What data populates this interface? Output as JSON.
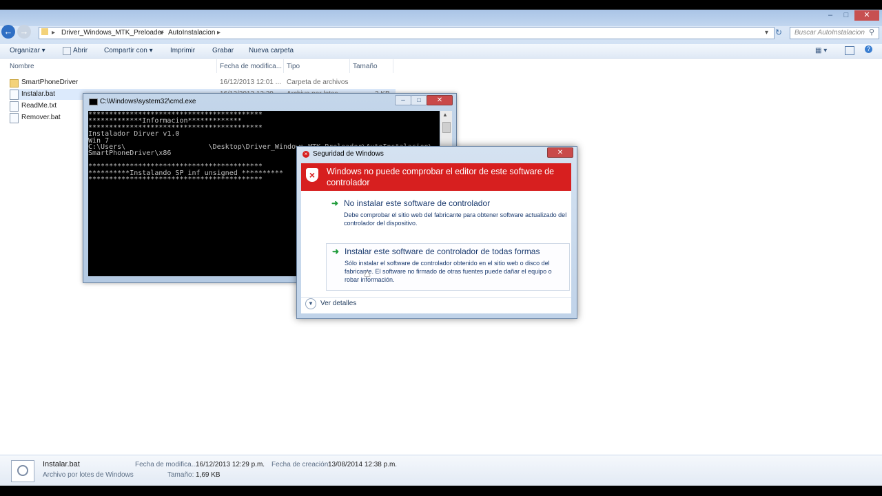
{
  "window": {
    "minimize": "–",
    "maximize": "□",
    "close": "✕"
  },
  "address": {
    "crumbs": [
      "Driver_Windows_MTK_Preloader",
      "AutoInstalacion"
    ],
    "search_placeholder": "Buscar AutoInstalacion"
  },
  "toolbar": {
    "items": [
      "Organizar",
      "Abrir",
      "Compartir con",
      "Imprimir",
      "Grabar",
      "Nueva carpeta"
    ]
  },
  "columns": {
    "name": "Nombre",
    "date": "Fecha de modifica...",
    "type": "Tipo",
    "size": "Tamaño"
  },
  "files": [
    {
      "name": "SmartPhoneDriver",
      "date": "16/12/2013 12:01 ...",
      "type": "Carpeta de archivos",
      "size": ""
    },
    {
      "name": "Instalar.bat",
      "date": "16/12/2013 12:29 ...",
      "type": "Archivo por lotes ...",
      "size": "2 KB"
    },
    {
      "name": "ReadMe.txt",
      "date": "",
      "type": "",
      "size": ""
    },
    {
      "name": "Remover.bat",
      "date": "",
      "type": "",
      "size": ""
    }
  ],
  "details": {
    "filename": "Instalar.bat",
    "filetype": "Archivo por lotes de Windows",
    "mod_label": "Fecha de modifica...",
    "mod_value": "16/12/2013 12:29 p.m.",
    "created_label": "Fecha de creación:",
    "created_value": "13/08/2014 12:38 p.m.",
    "size_label": "Tamaño:",
    "size_value": "1,69 KB"
  },
  "cmd": {
    "title": "C:\\Windows\\system32\\cmd.exe",
    "lines": "******************************************\n*************Informacion*************\n******************************************\nInstalador Dirver v1.0\nWin 7\nC:\\Users\\                    \\Desktop\\Driver_Windows_MTK_Preloader\\AutoInstalacion\\\nSmartPhoneDriver\\x86\n\n******************************************\n**********Instalando SP inf unsigned **********\n******************************************"
  },
  "security": {
    "title": "Seguridad de Windows",
    "header": "Windows no puede comprobar el editor de este software de controlador",
    "option1_title": "No instalar este software de controlador",
    "option1_desc": "Debe comprobar el sitio web del fabricante para obtener software actualizado del controlador del dispositivo.",
    "option2_title": "Instalar este software de controlador de todas formas",
    "option2_desc": "Sólo instalar el software de controlador obtenido en el sitio web o disco del fabricante. El software no firmado de otras fuentes puede dañar el equipo o robar información.",
    "details": "Ver detalles"
  },
  "colors": {
    "accent": "#1e395b",
    "danger": "#d71f1f",
    "arrow": "#1f9b3a"
  }
}
